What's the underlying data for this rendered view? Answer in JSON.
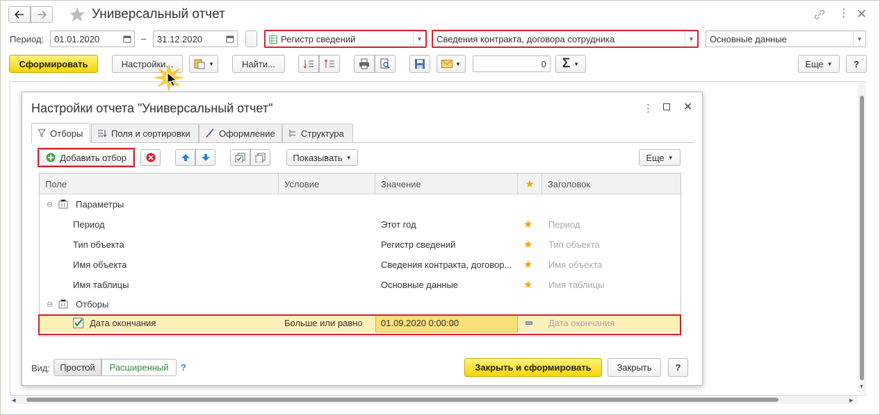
{
  "window": {
    "title": "Универсальный отчет"
  },
  "period": {
    "label": "Период:",
    "from": "01.01.2020",
    "dash": "–",
    "to": "31.12.2020"
  },
  "selectors": {
    "object_type": "Регистр сведений",
    "object_name": "Сведения контракта, договора сотрудника",
    "table_name": "Основные данные"
  },
  "toolbar": {
    "generate": "Сформировать",
    "settings": "Настройки...",
    "find": "Найти...",
    "number_value": "0",
    "sigma": "Σ",
    "more": "Еще",
    "help": "?"
  },
  "dialog": {
    "title": "Настройки отчета \"Универсальный отчет\"",
    "tabs": [
      {
        "label": "Отборы"
      },
      {
        "label": "Поля и сортировки"
      },
      {
        "label": "Оформление"
      },
      {
        "label": "Структура"
      }
    ],
    "toolbar": {
      "add_filter": "Добавить отбор",
      "show": "Показывать",
      "more": "Еще"
    },
    "columns": {
      "field": "Поле",
      "condition": "Условие",
      "value": "Значение",
      "header": "Заголовок"
    },
    "groups": {
      "params": "Параметры",
      "filters": "Отборы"
    },
    "rows": [
      {
        "field": "Период",
        "value": "Этот год",
        "header": "Период"
      },
      {
        "field": "Тип объекта",
        "value": "Регистр сведений",
        "header": "Тип объекта"
      },
      {
        "field": "Имя объекта",
        "value": "Сведения контракта, договор...",
        "header": "Имя объекта"
      },
      {
        "field": "Имя таблицы",
        "value": "Основные данные",
        "header": "Имя таблицы"
      }
    ],
    "filter_row": {
      "field": "Дата окончания",
      "condition": "Больше или равно",
      "value": "01.09.2020 0:00:00",
      "header": "Дата окончания"
    },
    "footer": {
      "view_label": "Вид:",
      "simple": "Простой",
      "extended": "Расширенный",
      "help_q": "?",
      "close_generate": "Закрыть и сформировать",
      "close": "Закрыть",
      "help": "?"
    }
  },
  "colors": {
    "accent_yellow": "#f5d60a",
    "highlight_red": "#d4202a",
    "star": "#f0a400",
    "selected_row": "#fdf1b9"
  }
}
